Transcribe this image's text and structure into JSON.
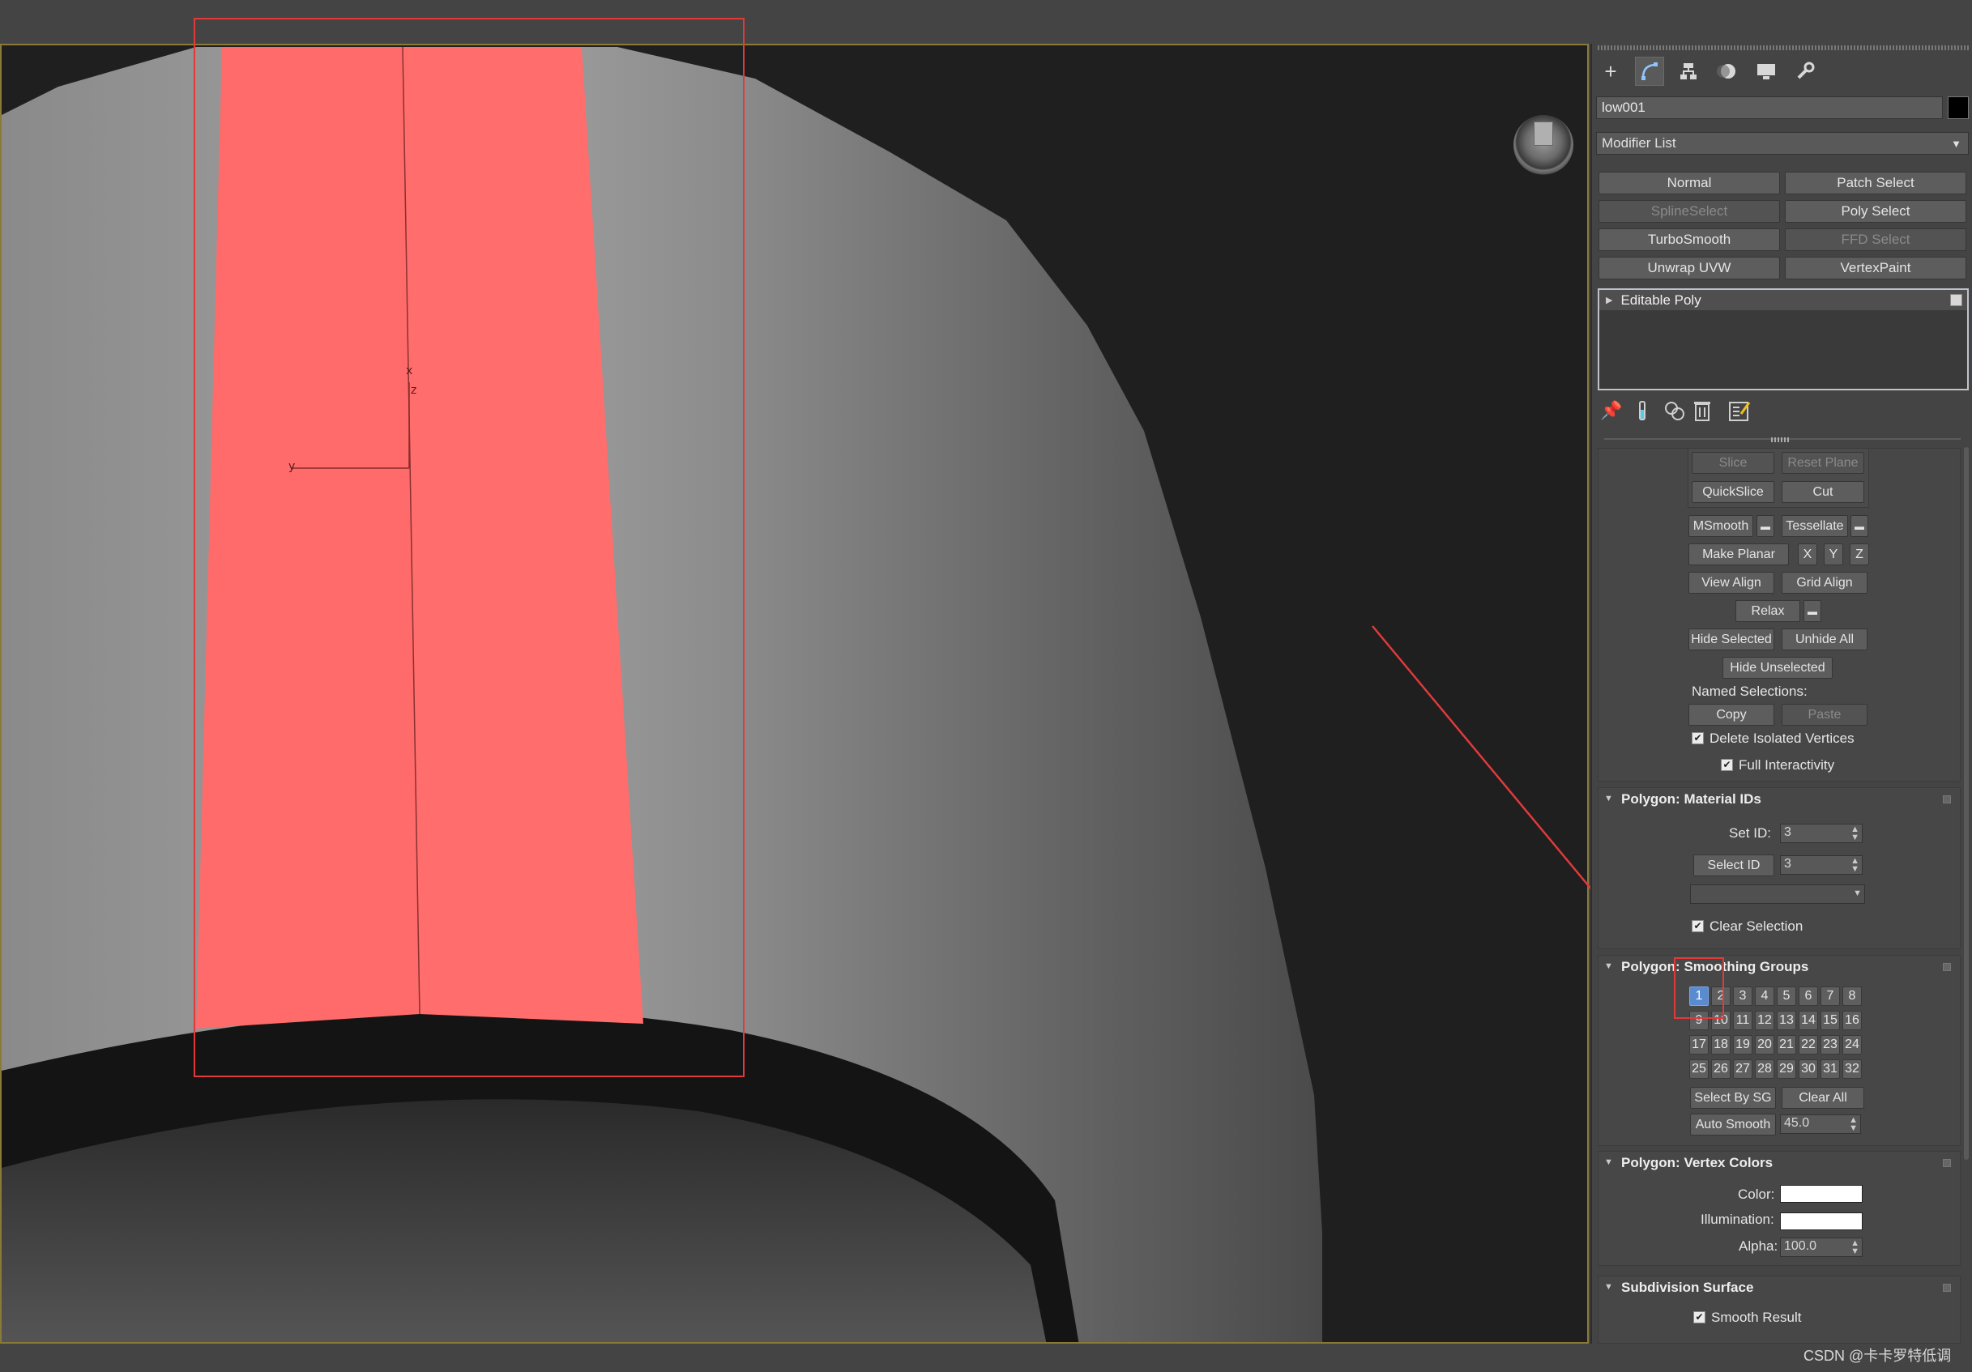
{
  "command_panel": {
    "tabs": [
      "create-icon",
      "modify-icon",
      "hierarchy-icon",
      "motion-icon",
      "display-icon",
      "utilities-icon"
    ],
    "object_name": "low001",
    "object_color": "#000000",
    "modifier_list_label": "Modifier List",
    "modifier_buttons": [
      {
        "label": "Normal",
        "enabled": true
      },
      {
        "label": "Patch Select",
        "enabled": true
      },
      {
        "label": "SplineSelect",
        "enabled": false
      },
      {
        "label": "Poly Select",
        "enabled": true
      },
      {
        "label": "TurboSmooth",
        "enabled": true
      },
      {
        "label": "FFD Select",
        "enabled": false
      },
      {
        "label": "Unwrap UVW",
        "enabled": true
      },
      {
        "label": "VertexPaint",
        "enabled": true
      }
    ],
    "stack_item": "Editable Poly"
  },
  "edit_geometry": {
    "slice": "Slice",
    "reset_plane": "Reset Plane",
    "quickslice": "QuickSlice",
    "cut": "Cut",
    "msmooth": "MSmooth",
    "tessellate": "Tessellate",
    "make_planar": "Make Planar",
    "x": "X",
    "y": "Y",
    "z": "Z",
    "view_align": "View Align",
    "grid_align": "Grid Align",
    "relax": "Relax",
    "hide_selected": "Hide Selected",
    "unhide_all": "Unhide All",
    "hide_unselected": "Hide Unselected",
    "named_selections": "Named Selections:",
    "copy": "Copy",
    "paste": "Paste",
    "delete_isolated": "Delete Isolated Vertices",
    "full_interactivity": "Full Interactivity"
  },
  "material_ids": {
    "title": "Polygon: Material IDs",
    "set_id_label": "Set ID:",
    "set_id_value": "3",
    "select_id_label": "Select ID",
    "select_id_value": "3",
    "clear_selection": "Clear Selection"
  },
  "smoothing_groups": {
    "title": "Polygon: Smoothing Groups",
    "groups": [
      "1",
      "2",
      "3",
      "4",
      "5",
      "6",
      "7",
      "8",
      "9",
      "10",
      "11",
      "12",
      "13",
      "14",
      "15",
      "16",
      "17",
      "18",
      "19",
      "20",
      "21",
      "22",
      "23",
      "24",
      "25",
      "26",
      "27",
      "28",
      "29",
      "30",
      "31",
      "32"
    ],
    "active": "1",
    "select_by_sg": "Select By SG",
    "clear_all": "Clear All",
    "auto_smooth": "Auto Smooth",
    "auto_smooth_value": "45.0"
  },
  "vertex_colors": {
    "title": "Polygon: Vertex Colors",
    "color_label": "Color:",
    "illumination_label": "Illumination:",
    "alpha_label": "Alpha:",
    "alpha_value": "100.0"
  },
  "subdivision": {
    "title": "Subdivision Surface",
    "smooth_result": "Smooth Result"
  },
  "viewport": {
    "gizmo_x": "x",
    "gizmo_y": "y",
    "gizmo_z": "z",
    "selected_color": "#ff6b6b",
    "annotation_color": "#e03a3a"
  },
  "watermark": "CSDN @卡卡罗特低调"
}
